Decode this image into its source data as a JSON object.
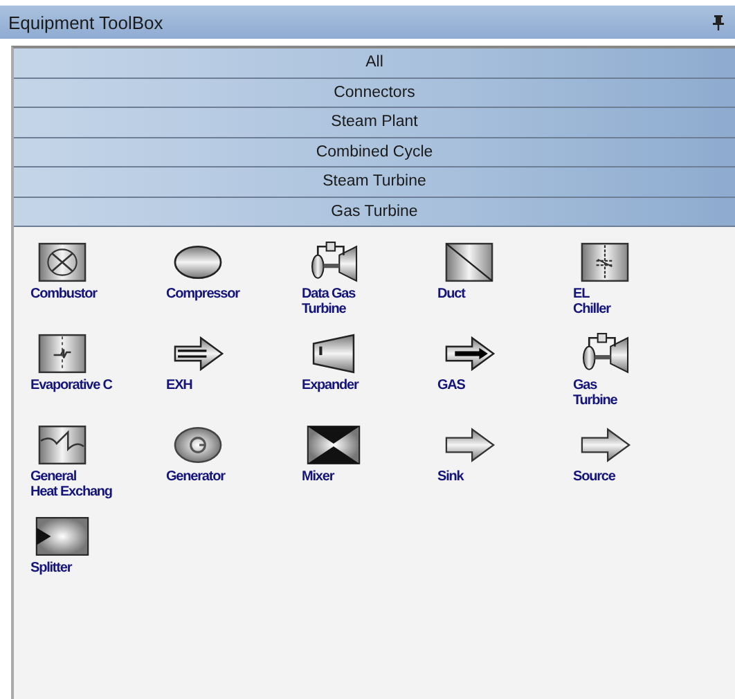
{
  "window": {
    "title": "Equipment ToolBox"
  },
  "categories": [
    {
      "label": "All"
    },
    {
      "label": "Connectors"
    },
    {
      "label": "Steam Plant"
    },
    {
      "label": "Combined Cycle"
    },
    {
      "label": "Steam Turbine"
    },
    {
      "label": "Gas Turbine"
    }
  ],
  "items": [
    {
      "label": "Combustor",
      "kind": "combustor"
    },
    {
      "label": "Compressor",
      "kind": "compressor"
    },
    {
      "label": "Data Gas\nTurbine",
      "kind": "turbine"
    },
    {
      "label": "Duct",
      "kind": "duct"
    },
    {
      "label": "EL\nChiller",
      "kind": "chiller"
    },
    {
      "label": "Evaporative C",
      "kind": "evaporative"
    },
    {
      "label": "EXH",
      "kind": "exh"
    },
    {
      "label": "Expander",
      "kind": "expander"
    },
    {
      "label": "GAS",
      "kind": "gas"
    },
    {
      "label": "Gas\nTurbine",
      "kind": "turbine"
    },
    {
      "label": "General\nHeat Exchang",
      "kind": "exchanger"
    },
    {
      "label": "Generator",
      "kind": "generator"
    },
    {
      "label": "Mixer",
      "kind": "mixer"
    },
    {
      "label": "Sink",
      "kind": "arrow"
    },
    {
      "label": "Source",
      "kind": "arrow"
    },
    {
      "label": "Splitter",
      "kind": "splitter"
    }
  ]
}
